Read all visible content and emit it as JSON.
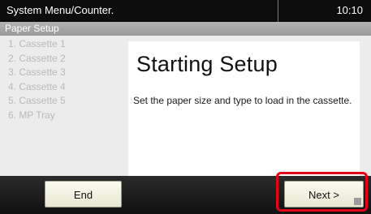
{
  "header": {
    "title": "System Menu/Counter.",
    "time": "10:10"
  },
  "subheader": {
    "label": "Paper Setup"
  },
  "steps": [
    "1. Cassette 1",
    "2. Cassette 2",
    "3. Cassette 3",
    "4. Cassette 4",
    "5. Cassette 5",
    "6. MP Tray"
  ],
  "panel": {
    "heading": "Starting Setup",
    "description": "Set the paper size and type to load in the cassette."
  },
  "footer": {
    "end_label": "End",
    "next_label": "Next >"
  },
  "colors": {
    "highlight": "#e4001a",
    "button_face": "#fbfbf0"
  }
}
